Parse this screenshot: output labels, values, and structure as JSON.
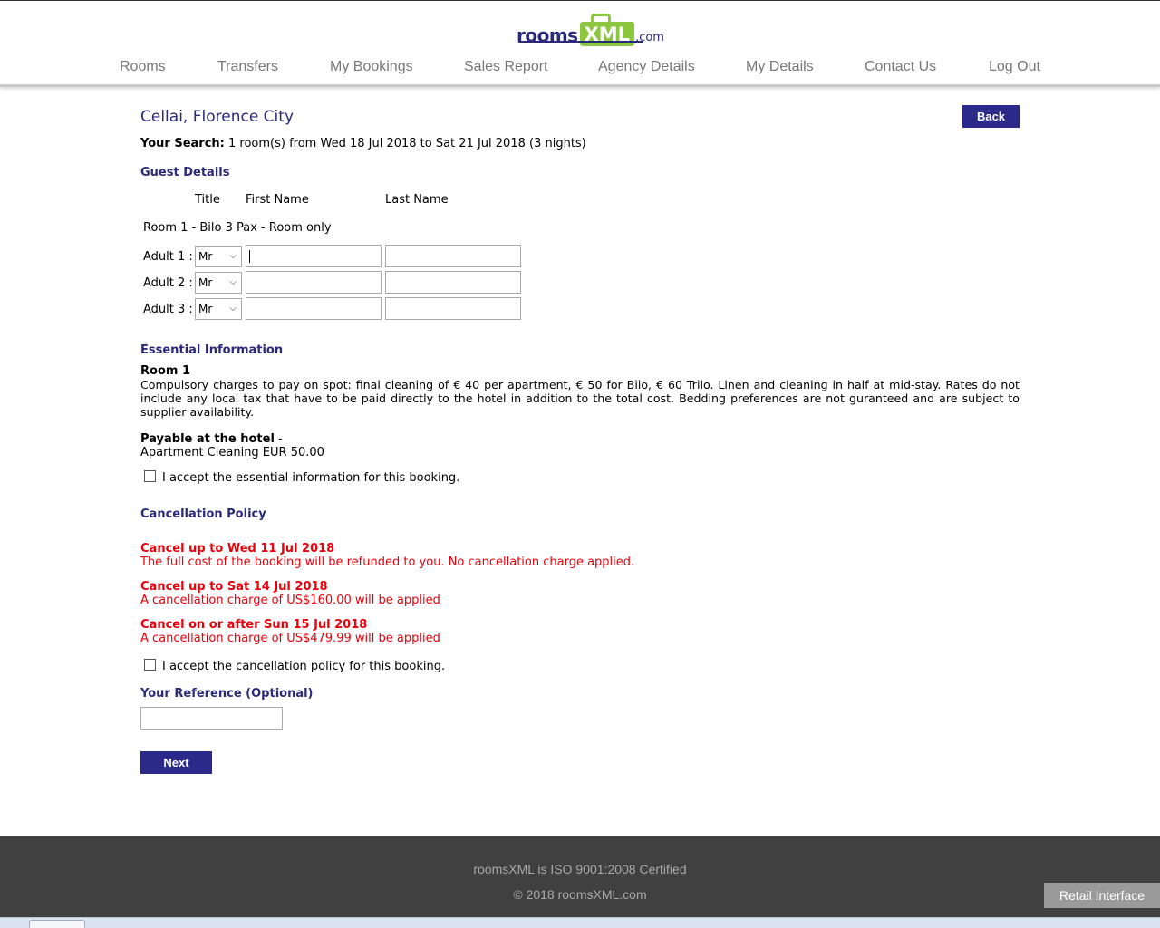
{
  "brand": {
    "rooms": "rooms",
    "xml": "XML",
    "com": ".com"
  },
  "nav": [
    "Rooms",
    "Transfers",
    "My Bookings",
    "Sales Report",
    "Agency Details",
    "My Details",
    "Contact Us",
    "Log Out"
  ],
  "page": {
    "title": "Cellai, Florence City",
    "back_label": "Back",
    "search_label": "Your Search:",
    "search_text": " 1 room(s) from Wed 18 Jul 2018 to Sat 21 Jul 2018 (3 nights)"
  },
  "guest_details": {
    "heading": "Guest Details",
    "col_title": "Title",
    "col_first": "First Name",
    "col_last": "Last Name",
    "room_label": "Room 1 - Bilo 3 Pax - Room only",
    "adults": [
      {
        "label": "Adult 1 :",
        "title": "Mr",
        "first": "",
        "last": ""
      },
      {
        "label": "Adult 2 :",
        "title": "Mr",
        "first": "",
        "last": ""
      },
      {
        "label": "Adult 3 :",
        "title": "Mr",
        "first": "",
        "last": ""
      }
    ]
  },
  "essential": {
    "heading": "Essential Information",
    "room": "Room 1",
    "text": "Compulsory charges to pay on spot: final cleaning of € 40 per apartment, € 50 for Bilo, € 60 Trilo. Linen and cleaning in half at mid-stay. Rates do not include any local tax that have to be paid directly to the hotel in addition to the total cost. Bedding preferences are not guranteed and are subject to supplier availability.",
    "payable_heading": "Payable at the hotel",
    "payable_dash": " -",
    "payable_item": "Apartment Cleaning EUR 50.00",
    "accept_label": "I accept the essential information for this booking."
  },
  "cancellation": {
    "heading": "Cancellation Policy",
    "rules": [
      {
        "title": "Cancel up to Wed 11 Jul 2018",
        "text": "The full cost of the booking will be refunded to you. No cancellation charge applied."
      },
      {
        "title": "Cancel up to Sat 14 Jul 2018",
        "text": "A cancellation charge of US$160.00 will be applied"
      },
      {
        "title": "Cancel on or after Sun 15 Jul 2018",
        "text": "A cancellation charge of US$479.99 will be applied"
      }
    ],
    "accept_label": "I accept the cancellation policy for this booking."
  },
  "reference": {
    "heading": "Your Reference (Optional)",
    "value": ""
  },
  "next_label": "Next",
  "footer": {
    "line1": "roomsXML is ISO 9001:2008 Certified",
    "line2": "© 2018 roomsXML.com",
    "retail_label": "Retail Interface"
  },
  "colors": {
    "brand_blue": "#2b2a7a",
    "brand_green": "#8dc63f",
    "alert_red": "#e8000b",
    "footer_bg": "#404040"
  }
}
